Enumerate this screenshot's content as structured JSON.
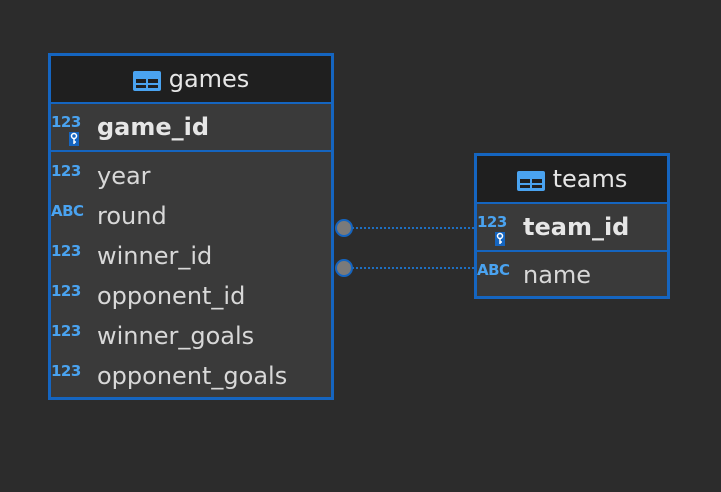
{
  "entities": {
    "games": {
      "title": "games",
      "pk": {
        "type": "123",
        "name": "game_id"
      },
      "columns": [
        {
          "type": "123",
          "name": "year"
        },
        {
          "type": "ABC",
          "name": "round"
        },
        {
          "type": "123",
          "name": "winner_id"
        },
        {
          "type": "123",
          "name": "opponent_id"
        },
        {
          "type": "123",
          "name": "winner_goals"
        },
        {
          "type": "123",
          "name": "opponent_goals"
        }
      ]
    },
    "teams": {
      "title": "teams",
      "pk": {
        "type": "123",
        "name": "team_id"
      },
      "columns": [
        {
          "type": "ABC",
          "name": "name"
        }
      ]
    }
  },
  "colors": {
    "border": "#1565c0",
    "type_tag": "#4aa3f0",
    "connector": "#1e6fc2",
    "endpoint": "#7a7a7a"
  }
}
